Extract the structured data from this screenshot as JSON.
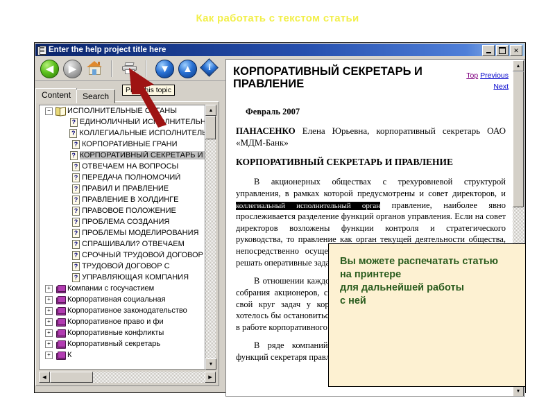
{
  "slide": {
    "title": "Как работать с текстом статьи",
    "title_color": "#f2ef4a"
  },
  "window": {
    "title": "Enter the help project title here",
    "icon": "help-book-icon",
    "buttons": {
      "minimize": "minimize-button",
      "maximize": "maximize-button",
      "close": "✕"
    }
  },
  "toolbar": {
    "items": [
      {
        "name": "back-button",
        "icon": "back-arrow-icon",
        "glyph": "◀"
      },
      {
        "name": "forward-button",
        "icon": "forward-arrow-icon",
        "glyph": "▶"
      },
      {
        "name": "home-button",
        "icon": "home-icon",
        "glyph": ""
      },
      {
        "name": "print-button",
        "icon": "printer-icon",
        "glyph": ""
      },
      {
        "name": "next-topic-button",
        "icon": "down-arrow-icon",
        "glyph": "▼"
      },
      {
        "name": "prev-topic-button",
        "icon": "up-arrow-icon",
        "glyph": "▲"
      },
      {
        "name": "about-button",
        "icon": "info-icon",
        "glyph": "i"
      }
    ],
    "tooltip": "Print this topic"
  },
  "tabs": [
    {
      "label": "Content",
      "active": true
    },
    {
      "label": "Search",
      "active": false
    }
  ],
  "tree": {
    "items": [
      {
        "label": "ИСПОЛНИТЕЛЬНЫЕ ОРГАНЫ",
        "icon": "open-book-icon",
        "indent": 8,
        "expander": "−",
        "selected": false
      },
      {
        "label": "ЕДИНОЛИЧНЫЙ ИСПОЛНИТЕЛЬНЫЙ ОРГАН",
        "icon": "question-page-icon",
        "indent": 34,
        "expander": "",
        "selected": false
      },
      {
        "label": "КОЛЛЕГИАЛЬНЫЕ ИСПОЛНИТЕЛЬНЫЕ ОРГАНЫ",
        "icon": "question-page-icon",
        "indent": 34,
        "expander": "",
        "selected": false
      },
      {
        "label": "КОРПОРАТИВНЫЕ ГРАНИ",
        "icon": "question-page-icon",
        "indent": 34,
        "expander": "",
        "selected": false
      },
      {
        "label": "КОРПОРАТИВНЫЙ СЕКРЕТАРЬ И ПРАВЛЕНИЕ",
        "icon": "question-page-icon",
        "indent": 34,
        "expander": "",
        "selected": true
      },
      {
        "label": "ОТВЕЧАЕМ НА ВОПРОСЫ",
        "icon": "question-page-icon",
        "indent": 34,
        "expander": "",
        "selected": false
      },
      {
        "label": "ПЕРЕДАЧА ПОЛНОМОЧИЙ",
        "icon": "question-page-icon",
        "indent": 34,
        "expander": "",
        "selected": false
      },
      {
        "label": "ПРАВИЛ И ПРАВЛЕНИЕ",
        "icon": "question-page-icon",
        "indent": 34,
        "expander": "",
        "selected": false
      },
      {
        "label": "ПРАВЛЕНИЕ В ХОЛДИНГЕ",
        "icon": "question-page-icon",
        "indent": 34,
        "expander": "",
        "selected": false
      },
      {
        "label": "ПРАВОВОЕ ПОЛОЖЕНИЕ",
        "icon": "question-page-icon",
        "indent": 34,
        "expander": "",
        "selected": false
      },
      {
        "label": "ПРОБЛЕМА СОЗДАНИЯ",
        "icon": "question-page-icon",
        "indent": 34,
        "expander": "",
        "selected": false
      },
      {
        "label": "ПРОБЛЕМЫ МОДЕЛИРОВАНИЯ",
        "icon": "question-page-icon",
        "indent": 34,
        "expander": "",
        "selected": false
      },
      {
        "label": "СПРАШИВАЛИ? ОТВЕЧАЕМ",
        "icon": "question-page-icon",
        "indent": 34,
        "expander": "",
        "selected": false
      },
      {
        "label": "СРОЧНЫЙ ТРУДОВОЙ ДОГОВОР",
        "icon": "question-page-icon",
        "indent": 34,
        "expander": "",
        "selected": false
      },
      {
        "label": "ТРУДОВОЙ ДОГОВОР С",
        "icon": "question-page-icon",
        "indent": 34,
        "expander": "",
        "selected": false
      },
      {
        "label": "УПРАВЛЯЮЩАЯ КОМПАНИЯ",
        "icon": "question-page-icon",
        "indent": 34,
        "expander": "",
        "selected": false
      },
      {
        "label": "Компании с госучастием",
        "icon": "closed-book-icon",
        "indent": 8,
        "expander": "+",
        "selected": false
      },
      {
        "label": "Корпоративная социальная",
        "icon": "closed-book-icon",
        "indent": 8,
        "expander": "+",
        "selected": false
      },
      {
        "label": "Корпоративное законодательство",
        "icon": "closed-book-icon",
        "indent": 8,
        "expander": "+",
        "selected": false
      },
      {
        "label": "Корпоративное право и фи",
        "icon": "closed-book-icon",
        "indent": 8,
        "expander": "+",
        "selected": false
      },
      {
        "label": "Корпоративные конфликты",
        "icon": "closed-book-icon",
        "indent": 8,
        "expander": "+",
        "selected": false
      },
      {
        "label": "Корпоративный секретарь",
        "icon": "closed-book-icon",
        "indent": 8,
        "expander": "+",
        "selected": false
      },
      {
        "label": "К",
        "icon": "closed-book-icon",
        "indent": 8,
        "expander": "+",
        "selected": false
      }
    ]
  },
  "document": {
    "heading": "КОРПОРАТИВНЫЙ СЕКРЕТАРЬ И ПРАВЛЕНИЕ",
    "nav": {
      "top": "Top",
      "previous": "Previous",
      "next": "Next"
    },
    "date": "Февраль 2007",
    "author_name": "ПАНАСЕНКО",
    "author_rest": "Елена Юрьевна, корпоративный секретарь ОАО «МДМ-Банк»",
    "subheading": "КОРПОРАТИВНЫЙ СЕКРЕТАРЬ И ПРАВЛЕНИЕ",
    "para1_a": "В акционерных обществах с трехуровневой структурой управления, в рамках которой предусмотрены и совет директоров, и ",
    "para1_highlight": "коллегиальный исполнительный орган",
    "para1_b": " правление, наиболее явно прослеживается разделение функций органов управления. Если на совет директоров возложены функции контроля и стратегического руководства, то правление как орган текущей деятельности общества, непосредственно осуществляющий руководство управления призван решать оперативные задачи.",
    "para2": "В отношении каждого из органов управления общества — общего собрания акционеров, совета директоров и правления — существует свой круг задач у корпоративного секретаря. В настоящей статье хотелось бы остановиться подробнее на характеристике взаимодействия в работе корпоративного секретаря и правления.",
    "para3": "В ряде компаний возложение на корпоративного секретаря функций секретаря правления"
  },
  "callout": {
    "lines": [
      "Вы можете распечатать статью",
      "на принтере",
      "для дальнейшей работы",
      "с ней"
    ],
    "text_color": "#2a5c1e",
    "background": "#fdf1d2"
  },
  "pointer": {
    "name": "red-arrow-pointer",
    "color": "#9e1313",
    "points_to": "print-button"
  }
}
